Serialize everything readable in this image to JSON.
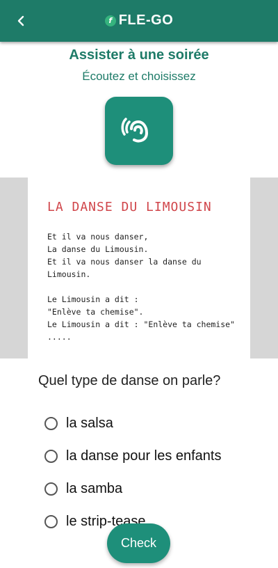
{
  "header": {
    "back_icon": "chevron-left-icon",
    "logo_letter": "f",
    "brand_name": "FLE-GO",
    "accent_color": "#1e7b68"
  },
  "activity": {
    "title": "Assister à une soirée",
    "subtitle": "Écoutez et choisissez",
    "audio_icon": "ear-icon"
  },
  "lyrics": {
    "title": "LA DANSE DU LIMOUSIN",
    "lines": [
      "Et il va nous danser,",
      "La danse du Limousin.",
      "Et il va nous danser la danse du",
      "Limousin.",
      "",
      "Le Limousin a dit :",
      "\"Enlève ta chemise\".",
      "Le Limousin a dit : \"Enlève ta chemise\"",
      "....."
    ]
  },
  "quiz": {
    "question": "Quel type de danse on parle?",
    "options": [
      "la salsa",
      "la danse pour les enfants",
      "la samba",
      "le strip-tease"
    ],
    "check_label": "Check"
  }
}
